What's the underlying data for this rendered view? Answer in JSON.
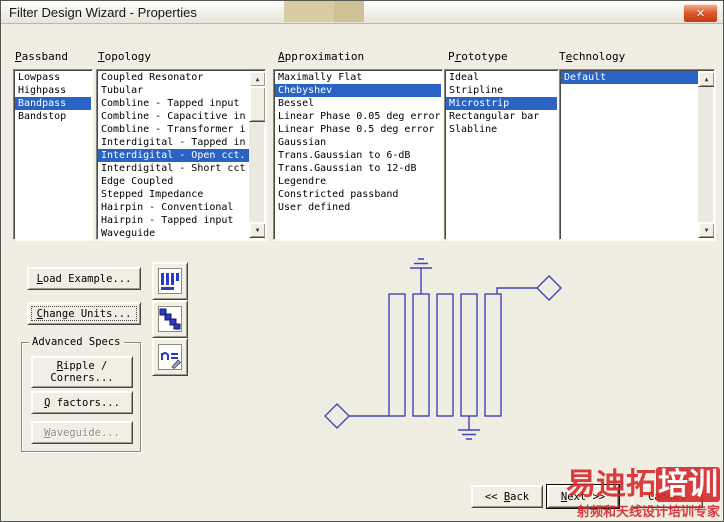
{
  "window": {
    "title": "Filter Design Wizard - Properties",
    "close_glyph": "✕"
  },
  "columns": {
    "passband": {
      "label_pre": "",
      "label_accel": "P",
      "label_post": "assband",
      "items": [
        "Lowpass",
        "Highpass",
        "Bandpass",
        "Bandstop"
      ],
      "selected": "Bandpass"
    },
    "topology": {
      "label_pre": "",
      "label_accel": "T",
      "label_post": "opology",
      "items": [
        "Coupled Resonator",
        "Tubular",
        "Combline - Tapped input",
        "Combline - Capacitive in",
        "Combline - Transformer i",
        "Interdigital - Tapped in",
        "Interdigital - Open cct.",
        "Interdigital - Short cct",
        "Edge Coupled",
        "Stepped Impedance",
        "Hairpin - Conventional",
        "Hairpin - Tapped input",
        "Waveguide"
      ],
      "selected": "Interdigital - Open cct."
    },
    "approximation": {
      "label_pre": "",
      "label_accel": "A",
      "label_post": "pproximation",
      "items": [
        "Maximally Flat",
        "Chebyshev",
        "Bessel",
        "Linear Phase 0.05 deg error",
        "Linear Phase 0.5 deg error",
        "Gaussian",
        "Trans.Gaussian to 6-dB",
        "Trans.Gaussian to 12-dB",
        "Legendre",
        "Constricted passband",
        "User defined"
      ],
      "selected": "Chebyshev"
    },
    "prototype": {
      "label_pre": "P",
      "label_accel": "r",
      "label_post": "ototype",
      "items": [
        "Ideal",
        "Stripline",
        "Microstrip",
        "Rectangular bar",
        "Slabline"
      ],
      "selected": "Microstrip"
    },
    "technology": {
      "label_pre": "T",
      "label_accel": "e",
      "label_post": "chnology",
      "items": [
        "Default"
      ],
      "selected": "Default"
    }
  },
  "buttons": {
    "load_example": {
      "pre": "",
      "accel": "L",
      "post": "oad Example..."
    },
    "change_units": {
      "pre": "",
      "accel": "C",
      "post": "hange Units..."
    },
    "advanced_specs": "Advanced Specs",
    "ripple_line1": {
      "pre": "",
      "accel": "R",
      "post": "ipple /"
    },
    "ripple_line2": "Corners...",
    "q_factors": {
      "pre": "",
      "accel": "Q",
      "post": " factors..."
    },
    "waveguide": {
      "pre": "",
      "accel": "W",
      "post": "aveguide..."
    },
    "back": {
      "pre": "<< ",
      "accel": "B",
      "post": "ack"
    },
    "next": {
      "pre": "",
      "accel": "N",
      "post": "ext >>"
    },
    "cancel": {
      "pre": "Cancel",
      "accel": "",
      "post": ""
    }
  },
  "icons": {
    "scroll_up": "▲",
    "scroll_down": "▼"
  },
  "watermark": {
    "title_main": "易迪拓",
    "title_boxed": "培训",
    "subtitle": "射频和天线设计培训专家"
  },
  "colors": {
    "selection_blue": "#2B63C4",
    "schematic_blue": "#4343B8",
    "watermark_red": "#D8282A",
    "dialog_bg": "#F0EEE3"
  }
}
